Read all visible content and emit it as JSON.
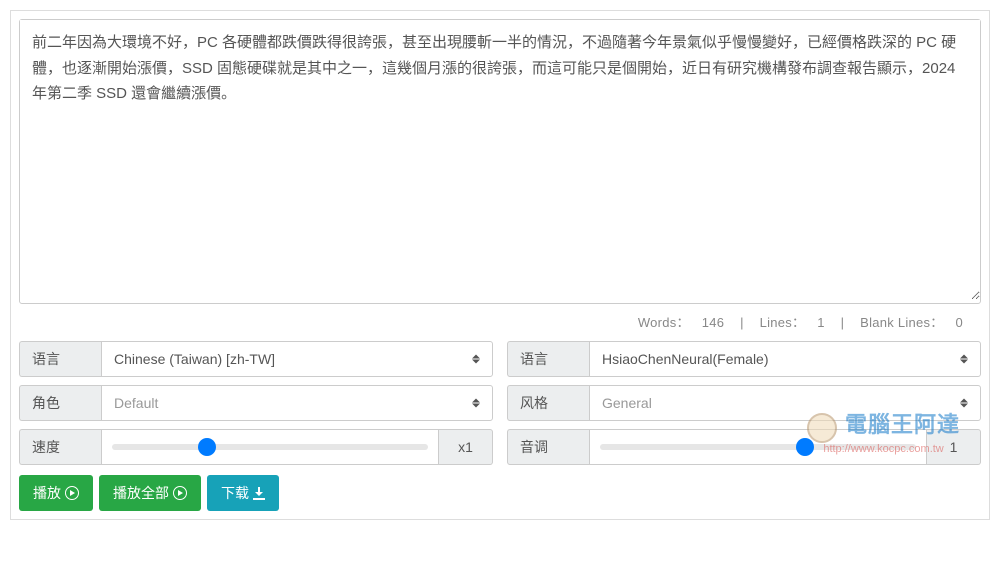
{
  "textarea": {
    "value": "前二年因為大環境不好，PC 各硬體都跌價跌得很誇張，甚至出現腰斬一半的情況，不過隨著今年景氣似乎慢慢變好，已經價格跌深的 PC 硬體，也逐漸開始漲價，SSD 固態硬碟就是其中之一，這幾個月漲的很誇張，而這可能只是個開始，近日有研究機構發布調查報告顯示，2024 年第二季 SSD 還會繼續漲價。"
  },
  "stats": {
    "words_label": "Words：",
    "words_value": "146",
    "lines_label": "Lines：",
    "lines_value": "1",
    "blank_label": "Blank Lines：",
    "blank_value": "0"
  },
  "left": {
    "lang_label": "语言",
    "lang_value": "Chinese (Taiwan) [zh-TW]",
    "role_label": "角色",
    "role_value": "Default",
    "speed_label": "速度",
    "speed_value": "x1",
    "speed_percent": 30
  },
  "right": {
    "voice_label": "语言",
    "voice_value": "HsiaoChenNeural(Female)",
    "style_label": "风格",
    "style_value": "General",
    "pitch_label": "音调",
    "pitch_value": "1",
    "pitch_percent": 65
  },
  "buttons": {
    "play": "播放",
    "play_all": "播放全部",
    "download": "下载"
  },
  "watermark": {
    "title": "電腦王阿達",
    "url": "http://www.kocpc.com.tw"
  }
}
